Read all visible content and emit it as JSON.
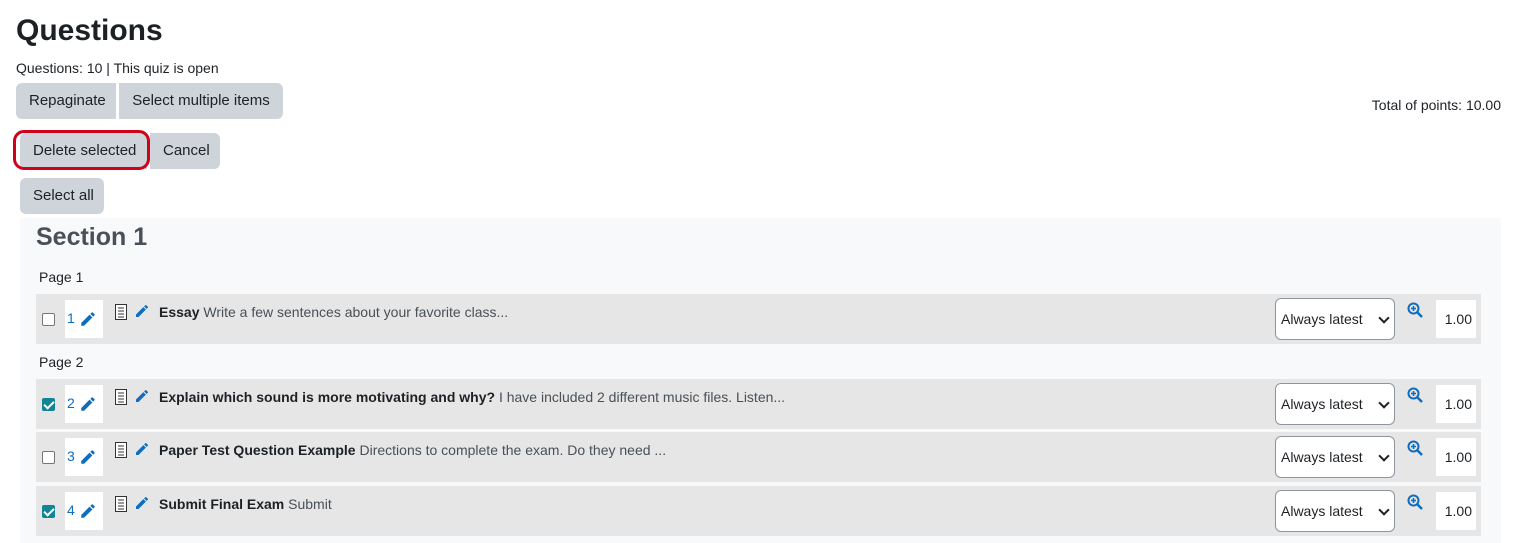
{
  "header": {
    "title": "Questions",
    "question_count": "Questions: 10",
    "separator": "|",
    "quiz_status": "This quiz is open",
    "total_points": "Total of points: 10.00"
  },
  "toolbar": {
    "repaginate_label": "Repaginate",
    "select_multiple_label": "Select multiple items",
    "delete_selected_label": "Delete selected",
    "cancel_label": "Cancel",
    "select_all_label": "Select all"
  },
  "section": {
    "title": "Section 1",
    "pages": [
      {
        "label": "Page 1",
        "questions": [
          {
            "number": "1",
            "checked": false,
            "name": "Essay",
            "text": "Write a few sentences about your favorite class...",
            "version": "Always latest",
            "mark": "1.00"
          }
        ]
      },
      {
        "label": "Page 2",
        "questions": [
          {
            "number": "2",
            "checked": true,
            "name": "Explain which sound is more motivating and why?",
            "text": "I have included 2 different music files. Listen...",
            "version": "Always latest",
            "mark": "1.00"
          },
          {
            "number": "3",
            "checked": false,
            "name": "Paper Test Question Example",
            "text": "Directions to complete the exam. Do they need ...",
            "version": "Always latest",
            "mark": "1.00"
          },
          {
            "number": "4",
            "checked": true,
            "name": "Submit Final Exam",
            "text": "Submit",
            "version": "Always latest",
            "mark": "1.00"
          }
        ]
      }
    ]
  },
  "colors": {
    "accent_checkbox": "#0f8595",
    "link_blue": "#0f6cbf",
    "highlight_outline": "#d0021b",
    "button_bg": "#ced4da"
  },
  "icons": [
    "edit-pencil-icon",
    "question-type-icon",
    "preview-zoom-icon",
    "chevron-down-icon"
  ]
}
